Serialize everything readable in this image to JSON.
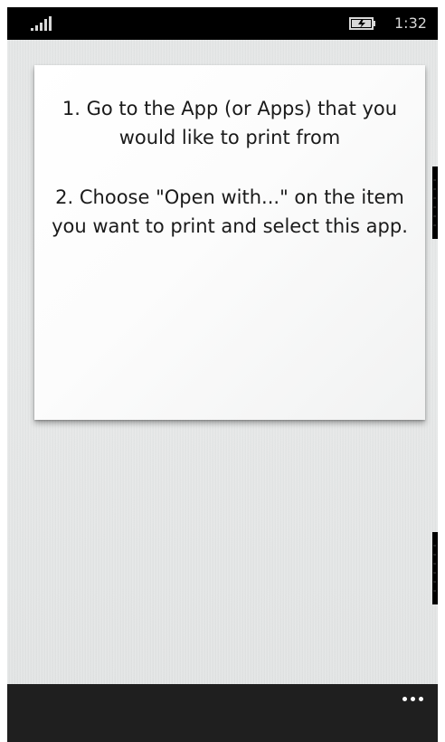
{
  "status_bar": {
    "time": "1:32",
    "signal_icon": "signal-strength-icon",
    "battery_icon": "battery-charging-icon"
  },
  "instructions": {
    "step1": "1. Go to the App (or Apps) that you would like to print from",
    "step2": "2. Choose \"Open with...\" on the item you want to print and select this app."
  },
  "app_bar": {
    "more_icon": "ellipsis-icon"
  },
  "colors": {
    "status_bar_bg": "#000000",
    "page_bg": "#e6e8e8",
    "card_bg": "#ffffff",
    "app_bar_bg": "#1f1f1f",
    "text": "#1a1a1a"
  }
}
